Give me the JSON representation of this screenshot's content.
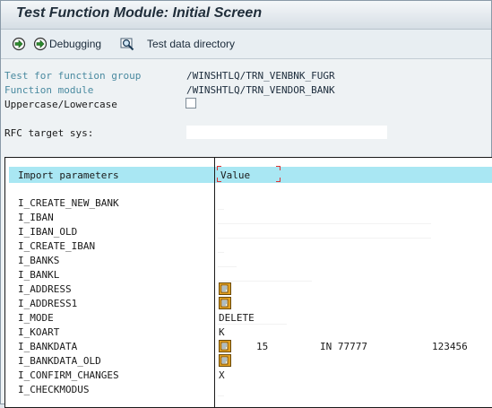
{
  "window": {
    "title": "Test Function Module: Initial Screen"
  },
  "toolbar": {
    "debugging_label": "Debugging",
    "test_data_label": "Test data directory"
  },
  "form": {
    "group_label": "Test for function group",
    "group_value": "/WINSHTLQ/TRN_VENBNK_FUGR",
    "module_label": "Function module",
    "module_value": "/WINSHTLQ/TRN_VENDOR_BANK",
    "case_label": "Uppercase/Lowercase",
    "rfc_label": "RFC target sys:"
  },
  "table": {
    "col1": "Import parameters",
    "col2": "Value",
    "rows": [
      {
        "name": "I_CREATE_NEW_BANK",
        "value": ""
      },
      {
        "name": "I_IBAN",
        "value": ""
      },
      {
        "name": "I_IBAN_OLD",
        "value": ""
      },
      {
        "name": "I_CREATE_IBAN",
        "value": ""
      },
      {
        "name": "I_BANKS",
        "value": ""
      },
      {
        "name": "I_BANKL",
        "value": ""
      },
      {
        "name": "I_ADDRESS",
        "value": "",
        "icon": "structure-edit-icon"
      },
      {
        "name": "I_ADDRESS1",
        "value": "",
        "icon": "structure-edit-icon"
      },
      {
        "name": "I_MODE",
        "value": "DELETE"
      },
      {
        "name": "I_KOART",
        "value": "K"
      },
      {
        "name": "I_BANKDATA",
        "value": "",
        "icon": "structure-edit-icon",
        "v1": "15",
        "v2": "IN 77777",
        "v3": "123456"
      },
      {
        "name": "I_BANKDATA_OLD",
        "value": "",
        "icon": "structure-edit-icon"
      },
      {
        "name": "I_CONFIRM_CHANGES",
        "value": "X"
      },
      {
        "name": "I_CHECKMODUS",
        "value": ""
      }
    ]
  },
  "colors": {
    "header_bg": "#a9e7f3",
    "label_blue": "#4a8aa0",
    "icon_orange": "#e3a020"
  }
}
